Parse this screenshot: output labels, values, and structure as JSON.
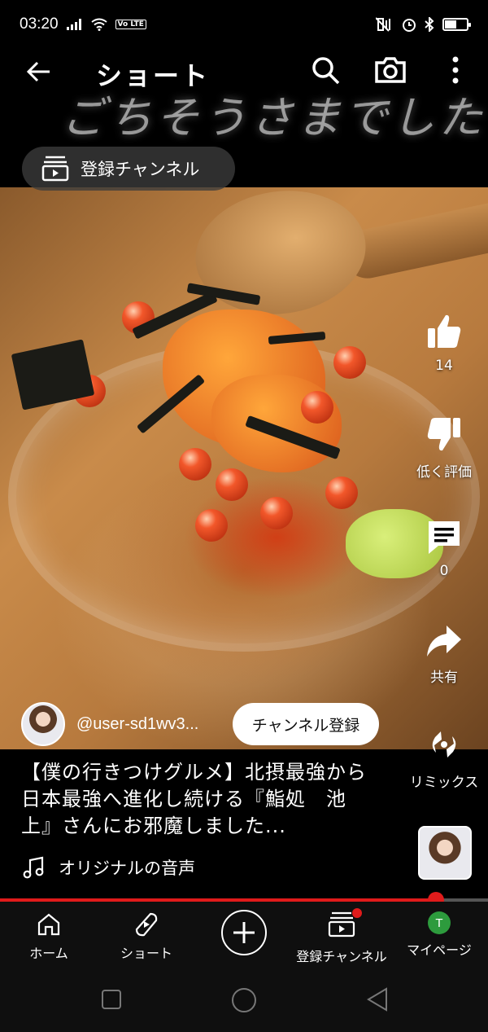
{
  "status_bar": {
    "time": "03:20",
    "volte": "Vo LTE"
  },
  "header": {
    "title": "ショート"
  },
  "video": {
    "overlay_text": "ごちそうさまでした"
  },
  "subscriptions_pill": {
    "label": "登録チャンネル"
  },
  "actions": {
    "like_count": "14",
    "dislike_label": "低く評価",
    "comment_count": "0",
    "share_label": "共有",
    "remix_label": "リミックス"
  },
  "author": {
    "handle": "@user-sd1wv3...",
    "subscribe_label": "チャンネル登録"
  },
  "description": "【僕の行きつけグルメ】北摂最強から日本最強へ進化し続ける『鮨処　池上』さんにお邪魔しました...",
  "audio": {
    "label": "オリジナルの音声"
  },
  "progress": {
    "fraction": 0.893
  },
  "bottom_nav": {
    "home": "ホーム",
    "shorts": "ショート",
    "subscriptions": "登録チャンネル",
    "mypage": "マイページ",
    "avatar_letter": "T"
  },
  "colors": {
    "accent": "#e01b1b",
    "avatar_bg": "#2d9b3d",
    "pill_bg": "#3c3c3c"
  }
}
